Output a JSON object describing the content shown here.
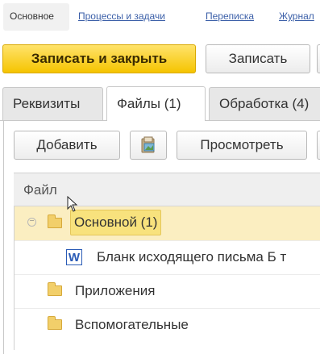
{
  "nav": {
    "items": [
      {
        "label": "Основное"
      },
      {
        "label": "Процессы и задачи"
      },
      {
        "label": "Переписка"
      },
      {
        "label": "Журнал"
      }
    ]
  },
  "actions": {
    "save_close": "Записать и закрыть",
    "save": "Записать"
  },
  "tabs": [
    {
      "label": "Реквизиты"
    },
    {
      "label": "Файлы (1)"
    },
    {
      "label": "Обработка (4)"
    }
  ],
  "toolbar": {
    "add": "Добавить",
    "view": "Просмотреть"
  },
  "grid": {
    "header": "Файл",
    "rows": [
      {
        "label": "Основной (1)",
        "type": "folder",
        "expanded": true
      },
      {
        "label": "Бланк исходящего письма Б т",
        "type": "word-file"
      },
      {
        "label": "Приложения",
        "type": "folder"
      },
      {
        "label": "Вспомогательные",
        "type": "folder"
      }
    ]
  },
  "colors": {
    "primary_button": "#f5c400",
    "selected_row": "#fbeec1",
    "link": "#3b5fa8"
  }
}
